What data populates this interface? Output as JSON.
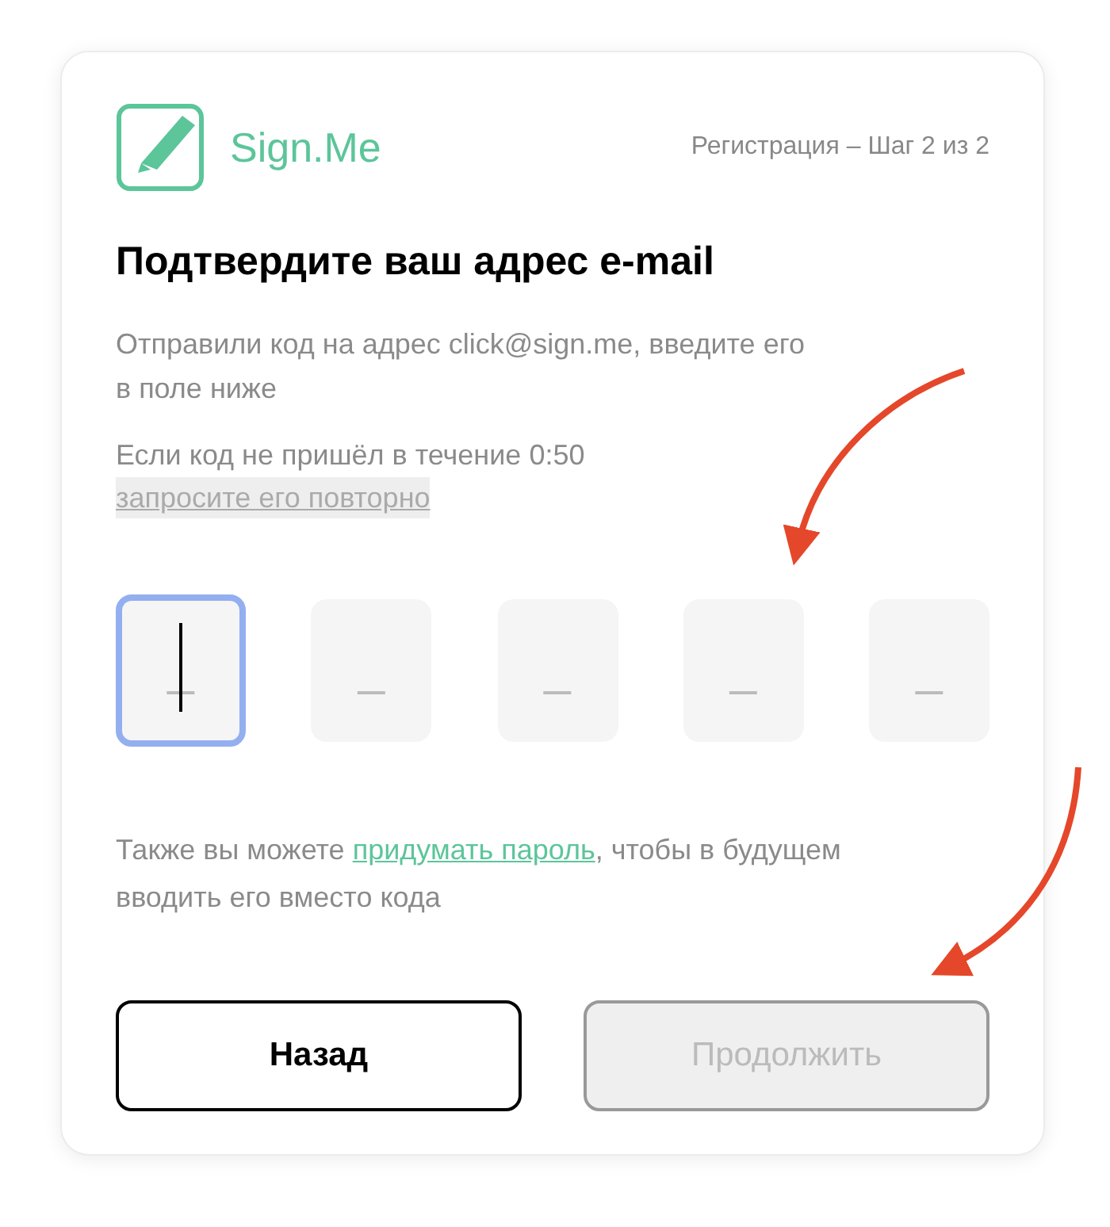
{
  "brand": {
    "name": "Sign.Me"
  },
  "step": "Регистрация – Шаг 2 из 2",
  "title": "Подтвердите ваш адрес e-mail",
  "sent_note": "Отправили код на адрес click@sign.me, введите его в поле ниже",
  "resend": {
    "text": "Если код не пришёл в течение 0:50",
    "link": "запросите его повторно",
    "disabled": true
  },
  "code_cells": [
    {
      "placeholder": "_",
      "focused": true
    },
    {
      "placeholder": "_",
      "focused": false
    },
    {
      "placeholder": "_",
      "focused": false
    },
    {
      "placeholder": "_",
      "focused": false
    },
    {
      "placeholder": "_",
      "focused": false
    }
  ],
  "password_note": {
    "before": "Также вы можете",
    "link": "придумать пароль",
    "after": ", чтобы в будущем вводить его вместо кода"
  },
  "buttons": [
    {
      "label": "Назад",
      "disabled": false
    },
    {
      "label": "Продолжить",
      "disabled": true
    }
  ]
}
